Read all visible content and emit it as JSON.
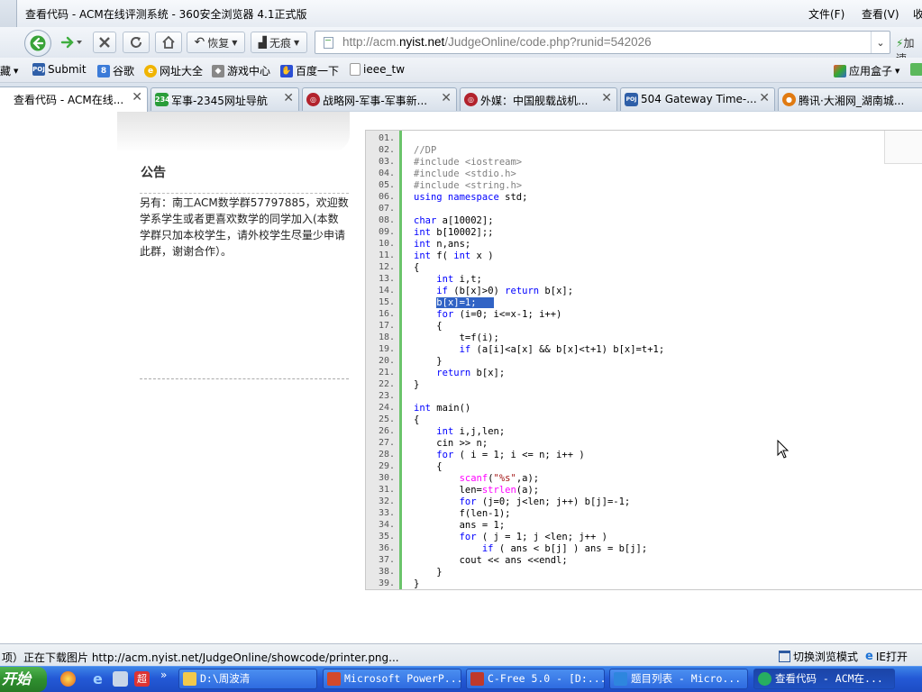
{
  "window": {
    "title": "查看代码 - ACM在线评测系统 - 360安全浏览器 4.1正式版",
    "user_label": "录",
    "menu": [
      "文件(F)",
      "查看(V)",
      "收"
    ]
  },
  "nav": {
    "restore_label": "恢复",
    "incognito_label": "无痕",
    "url_prefix": "http://acm.",
    "url_domain": "nyist.net",
    "url_path": "/JudgeOnline/code.php?runid=542026",
    "add_label": "加速"
  },
  "bookmarks": {
    "left_stub": "藏",
    "items": [
      "Submit",
      "谷歌",
      "网址大全",
      "游戏中心",
      "百度一下",
      "ieee_tw"
    ],
    "app_box": "应用盒子"
  },
  "tabs": [
    {
      "label": "查看代码 - ACM在线...",
      "active": true,
      "color": "#2d7ad6"
    },
    {
      "label": "军事-2345网址导航",
      "active": false,
      "color": "#2a9d3a"
    },
    {
      "label": "战略网-军事-军事新...",
      "active": false,
      "color": "#b2222c"
    },
    {
      "label": "外媒：中国舰载战机...",
      "active": false,
      "color": "#b2222c"
    },
    {
      "label": "504 Gateway Time-...",
      "active": false,
      "color": "#2f5fa8"
    },
    {
      "label": "腾讯·大湘网_湖南城...",
      "active": false,
      "color": "#e07a12"
    }
  ],
  "page": {
    "notice_title": "公告",
    "notice_body": "另有：南工ACM数学群57797885，欢迎数学系学生或者更喜欢数学的同学加入(本数学群只加本校学生，请外校学生尽量少申请此群，谢谢合作）。",
    "code_lines": [
      {
        "n": "01.",
        "html": ""
      },
      {
        "n": "02.",
        "html": "<span class='c'>//DP</span>"
      },
      {
        "n": "03.",
        "html": "<span class='c'>#include &lt;iostream&gt;</span>"
      },
      {
        "n": "04.",
        "html": "<span class='c'>#include &lt;stdio.h&gt;</span>"
      },
      {
        "n": "05.",
        "html": "<span class='c'>#include &lt;string.h&gt;</span>"
      },
      {
        "n": "06.",
        "html": "<span class='k'>using namespace</span> std;"
      },
      {
        "n": "07.",
        "html": ""
      },
      {
        "n": "08.",
        "html": "<span class='k'>char</span> a[10002];"
      },
      {
        "n": "09.",
        "html": "<span class='k'>int</span> b[10002];;"
      },
      {
        "n": "10.",
        "html": "<span class='k'>int</span> n,ans;"
      },
      {
        "n": "11.",
        "html": "<span class='k'>int</span> f( <span class='k'>int</span> x )"
      },
      {
        "n": "12.",
        "html": "{"
      },
      {
        "n": "13.",
        "html": "    <span class='k'>int</span> i,t;"
      },
      {
        "n": "14.",
        "html": "    <span class='k'>if</span> (b[x]&gt;0) <span class='k'>return</span> b[x];"
      },
      {
        "n": "15.",
        "html": "    <span class='sel'>b[x]=1;   </span>"
      },
      {
        "n": "16.",
        "html": "    <span class='k'>for</span> (i=0; i&lt;=x-1; i++)"
      },
      {
        "n": "17.",
        "html": "    {"
      },
      {
        "n": "18.",
        "html": "        t=f(i);"
      },
      {
        "n": "19.",
        "html": "        <span class='k'>if</span> (a[i]&lt;a[x] &amp;&amp; b[x]&lt;t+1) b[x]=t+1;"
      },
      {
        "n": "20.",
        "html": "    }"
      },
      {
        "n": "21.",
        "html": "    <span class='k'>return</span> b[x];"
      },
      {
        "n": "22.",
        "html": "}"
      },
      {
        "n": "23.",
        "html": ""
      },
      {
        "n": "24.",
        "html": "<span class='k'>int</span> main()"
      },
      {
        "n": "25.",
        "html": "{"
      },
      {
        "n": "26.",
        "html": "    <span class='k'>int</span> i,j,len;"
      },
      {
        "n": "27.",
        "html": "    cin &gt;&gt; n;"
      },
      {
        "n": "28.",
        "html": "    <span class='k'>for</span> ( i = 1; i &lt;= n; i++ )"
      },
      {
        "n": "29.",
        "html": "    {"
      },
      {
        "n": "30.",
        "html": "        <span class='f'>scanf</span>(<span class='s'>\"%s\"</span>,a);"
      },
      {
        "n": "31.",
        "html": "        len=<span class='f'>strlen</span>(a);"
      },
      {
        "n": "32.",
        "html": "        <span class='k'>for</span> (j=0; j&lt;len; j++) b[j]=-1;"
      },
      {
        "n": "33.",
        "html": "        f(len-1);"
      },
      {
        "n": "34.",
        "html": "        ans = 1;"
      },
      {
        "n": "35.",
        "html": "        <span class='k'>for</span> ( j = 1; j &lt;len; j++ )"
      },
      {
        "n": "36.",
        "html": "            <span class='k'>if</span> ( ans &lt; b[j] ) ans = b[j];"
      },
      {
        "n": "37.",
        "html": "        cout &lt;&lt; ans &lt;&lt;endl;"
      },
      {
        "n": "38.",
        "html": "    }"
      },
      {
        "n": "39.",
        "html": "}"
      }
    ]
  },
  "status": {
    "text": "项）正在下载图片 http://acm.nyist.net/JudgeOnline/showcode/printer.png...",
    "switch_mode": "切换浏览模式",
    "ie_open": "IE打开"
  },
  "taskbar": {
    "start_label": "开始",
    "chevron": "»",
    "items": [
      {
        "label": "D:\\周波清",
        "color": "#f2c94c",
        "active": false
      },
      {
        "label": "Microsoft PowerP...",
        "color": "#d2492b",
        "active": false
      },
      {
        "label": "C-Free 5.0 - [D:...",
        "color": "#c0392b",
        "active": false
      },
      {
        "label": "题目列表 - Micro...",
        "color": "#2e86de",
        "active": false
      },
      {
        "label": "查看代码 - ACM在...",
        "color": "#27ae60",
        "active": true
      }
    ]
  }
}
